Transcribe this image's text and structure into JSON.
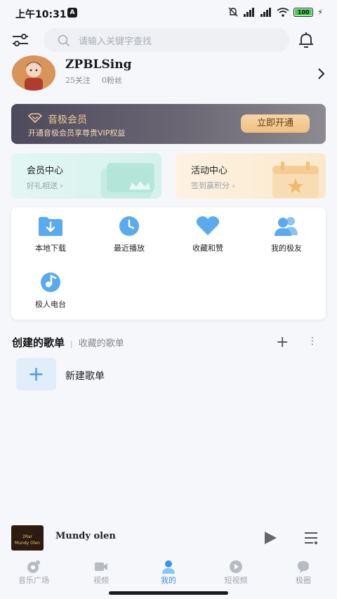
{
  "status_bar": {
    "time": "上午10:31",
    "badge": "A",
    "battery": "100"
  },
  "search": {
    "placeholder": "请输入关键字查找"
  },
  "profile": {
    "username": "ZPBLSing",
    "following": "25关注",
    "fans": "0粉丝"
  },
  "vip": {
    "title": "音极会员",
    "subtitle": "开通音极会员享尊贵VIP权益",
    "button": "立即开通",
    "accent": "#f2c98f"
  },
  "cards": [
    {
      "title": "会员中心",
      "subtitle": "好礼相送 ›"
    },
    {
      "title": "活动中心",
      "subtitle": "签到赢积分 ›"
    }
  ],
  "grid": [
    {
      "label": "本地下载",
      "icon": "download-folder-icon"
    },
    {
      "label": "最近播放",
      "icon": "clock-icon"
    },
    {
      "label": "收藏和赞",
      "icon": "heart-icon"
    },
    {
      "label": "我的极友",
      "icon": "friends-icon"
    },
    {
      "label": "极人电台",
      "icon": "radio-icon"
    }
  ],
  "playlists": {
    "tab_active": "创建的歌单",
    "separator": "|",
    "tab_other": "收藏的歌单",
    "add": "+",
    "more": "⋮",
    "new_label": "新建歌单"
  },
  "player": {
    "title": "Mundy olen",
    "cover_line1": "2Rar",
    "cover_line2": "Mundy Olen"
  },
  "nav": [
    {
      "label": "音乐广场",
      "icon": "music-square-icon"
    },
    {
      "label": "视频",
      "icon": "video-camera-icon"
    },
    {
      "label": "我的",
      "icon": "user-icon"
    },
    {
      "label": "短视频",
      "icon": "short-video-icon"
    },
    {
      "label": "极圈",
      "icon": "circle-icon"
    }
  ],
  "colors": {
    "primary_blue": "#3c94e8",
    "icon_blue": "#5aaaf0"
  }
}
